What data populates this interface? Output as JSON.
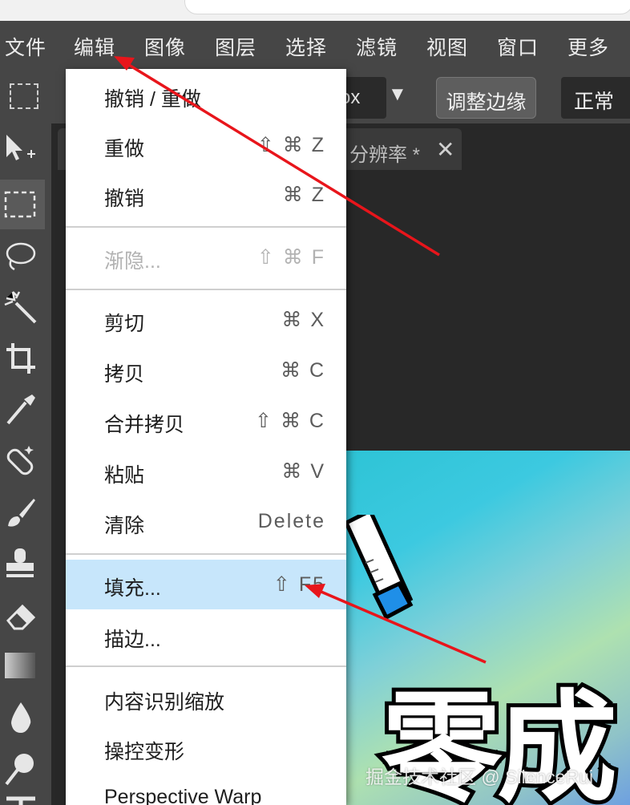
{
  "menubar": {
    "items": [
      {
        "label": "文件"
      },
      {
        "label": "编辑"
      },
      {
        "label": "图像"
      },
      {
        "label": "图层"
      },
      {
        "label": "选择"
      },
      {
        "label": "滤镜"
      },
      {
        "label": "视图"
      },
      {
        "label": "窗口"
      },
      {
        "label": "更多"
      }
    ]
  },
  "options": {
    "size_value": "ox",
    "refine_edge": "调整边缘",
    "blend_mode": "正常"
  },
  "doc_tab": {
    "title": "分辨率 *",
    "close": "✕"
  },
  "edit_menu": {
    "items": [
      {
        "label": "撤销 / 重做",
        "shortcut": ""
      },
      {
        "label": "重做",
        "shortcut": "⇧ ⌘ Z"
      },
      {
        "label": "撤销",
        "shortcut": "⌘ Z"
      },
      {
        "label": "渐隐...",
        "shortcut": "⇧ ⌘ F"
      },
      {
        "label": "剪切",
        "shortcut": "⌘ X"
      },
      {
        "label": "拷贝",
        "shortcut": "⌘ C"
      },
      {
        "label": "合并拷贝",
        "shortcut": "⇧ ⌘ C"
      },
      {
        "label": "粘贴",
        "shortcut": "⌘ V"
      },
      {
        "label": "清除",
        "shortcut": "Delete"
      },
      {
        "label": "填充...",
        "shortcut": "⇧ F5"
      },
      {
        "label": "描边...",
        "shortcut": ""
      },
      {
        "label": "内容识别缩放",
        "shortcut": ""
      },
      {
        "label": "操控变形",
        "shortcut": ""
      },
      {
        "label": "Perspective Warp",
        "shortcut": ""
      }
    ]
  },
  "canvas": {
    "headline": "零成",
    "watermark": "掘金技术社区 @ SilenceRui"
  },
  "colors": {
    "menubar_bg": "#464646",
    "workspace_bg": "#282828",
    "menu_highlight": "#c7e6fb",
    "annotation": "#e8151b"
  }
}
